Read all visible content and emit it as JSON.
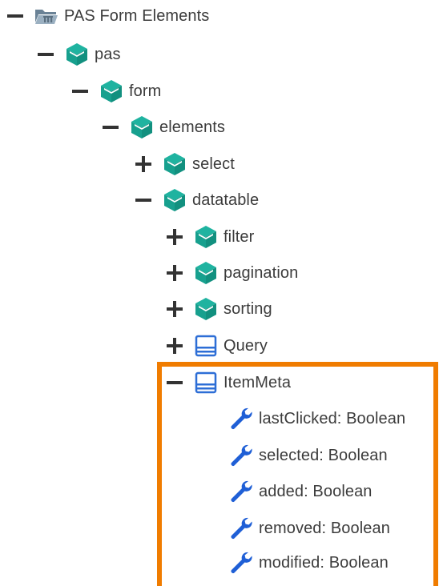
{
  "tree": {
    "root": {
      "label": "PAS Form Elements",
      "toggle": "minus",
      "icon": "folder-icon"
    },
    "pas": {
      "label": "pas",
      "toggle": "minus",
      "icon": "package-icon"
    },
    "form": {
      "label": "form",
      "toggle": "minus",
      "icon": "package-icon"
    },
    "elements": {
      "label": "elements",
      "toggle": "minus",
      "icon": "package-icon"
    },
    "select": {
      "label": "select",
      "toggle": "plus",
      "icon": "package-icon"
    },
    "datatable": {
      "label": "datatable",
      "toggle": "minus",
      "icon": "package-icon"
    },
    "filter": {
      "label": "filter",
      "toggle": "plus",
      "icon": "package-icon"
    },
    "pagination": {
      "label": "pagination",
      "toggle": "plus",
      "icon": "package-icon"
    },
    "sorting": {
      "label": "sorting",
      "toggle": "plus",
      "icon": "package-icon"
    },
    "query": {
      "label": "Query",
      "toggle": "plus",
      "icon": "class-icon"
    },
    "itemmeta": {
      "label": "ItemMeta",
      "toggle": "minus",
      "icon": "class-icon"
    },
    "attributes": [
      {
        "label": "lastClicked: Boolean",
        "icon": "wrench-icon"
      },
      {
        "label": "selected: Boolean",
        "icon": "wrench-icon"
      },
      {
        "label": "added: Boolean",
        "icon": "wrench-icon"
      },
      {
        "label": "removed: Boolean",
        "icon": "wrench-icon"
      },
      {
        "label": "modified: Boolean",
        "icon": "wrench-icon"
      }
    ]
  },
  "colors": {
    "package": "#1fb3a0",
    "class": "#2d6ed6",
    "wrench": "#1f5fd6",
    "highlight": "#f07c00",
    "toggle": "#333333",
    "text": "#3c3c3c"
  }
}
